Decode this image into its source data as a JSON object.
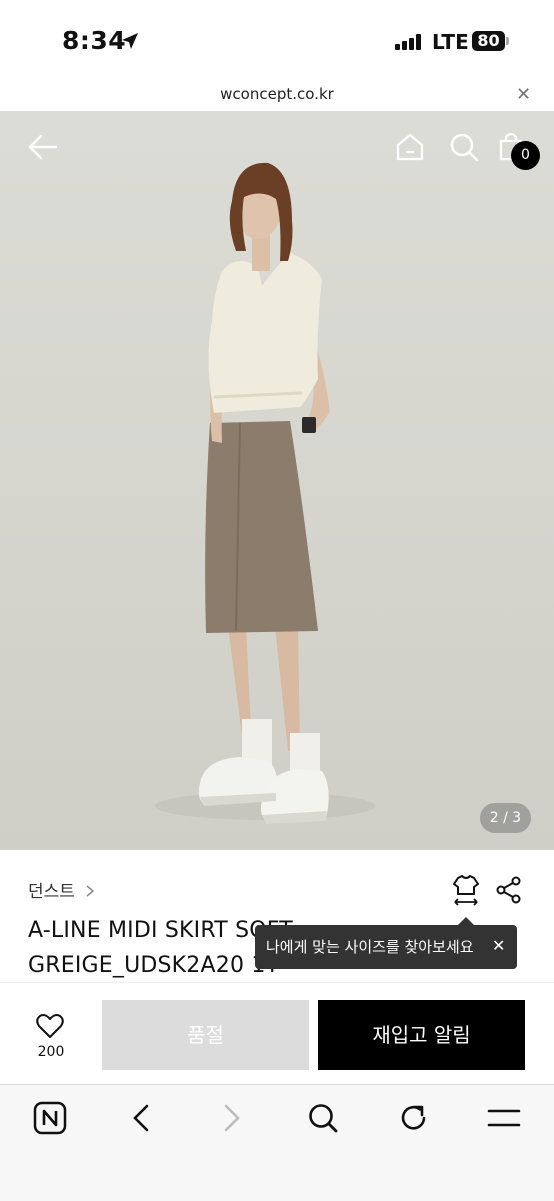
{
  "status_bar": {
    "time": "8:34",
    "network": "LTE",
    "battery": "80"
  },
  "browser": {
    "url": "wconcept.co.kr"
  },
  "product_image": {
    "counter": "2 / 3"
  },
  "header_icons": {
    "cart_count": "0"
  },
  "product": {
    "brand": "던스트",
    "title_line1": "A-LINE MIDI SKIRT SOFT",
    "title_line2": "GREIGE_UDSK2A20 1T"
  },
  "tooltip": {
    "text": "나에게 맞는 사이즈를 찾아보세요"
  },
  "actions": {
    "like_count": "200",
    "soldout_label": "품절",
    "restock_label": "재입고 알림"
  },
  "icons": [
    "location-arrow-icon",
    "signal-icon",
    "battery-icon",
    "close-icon",
    "back-arrow-icon",
    "home-icon",
    "search-icon",
    "cart-icon",
    "chevron-right-icon",
    "size-guide-icon",
    "share-icon",
    "heart-icon",
    "naver-icon",
    "browser-back-icon",
    "browser-forward-icon",
    "reload-icon",
    "menu-icon"
  ]
}
